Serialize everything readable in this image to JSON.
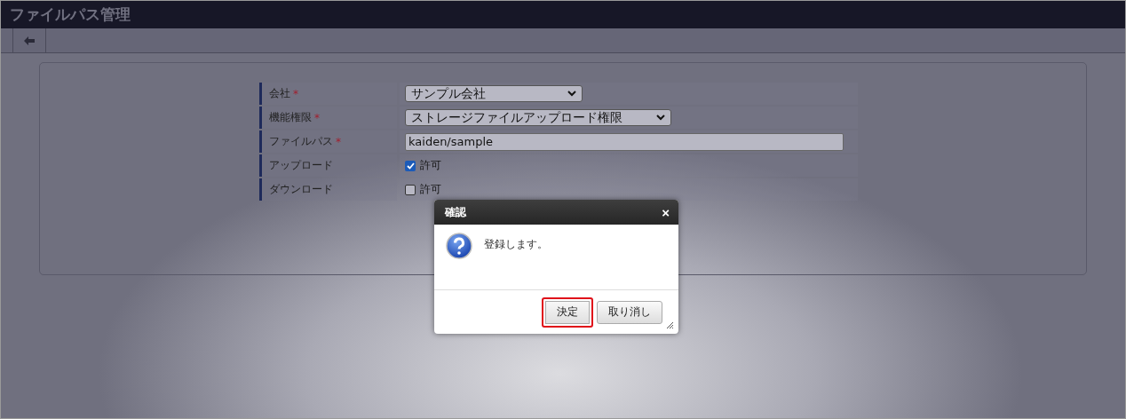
{
  "window": {
    "title": "ファイルパス管理"
  },
  "form": {
    "rows": [
      {
        "label": "会社",
        "mark": "*",
        "kind": "select",
        "value": "サンプル会社"
      },
      {
        "label": "機能権限",
        "mark": "*",
        "kind": "select",
        "value": "ストレージファイルアップロード権限"
      },
      {
        "label": "ファイルパス",
        "mark": "*",
        "kind": "text",
        "value": "kaiden/sample"
      },
      {
        "label": "アップロード",
        "kind": "checkbox",
        "checked": true,
        "value": "許可"
      },
      {
        "label": "ダウンロード",
        "kind": "checkbox",
        "checked": false,
        "value": "許可"
      }
    ]
  },
  "dialog": {
    "title": "確認",
    "close": "×",
    "message": "登録します。",
    "buttons": [
      {
        "label": "決定",
        "highlighted": true
      },
      {
        "label": "取り消し",
        "highlighted": false
      }
    ]
  }
}
